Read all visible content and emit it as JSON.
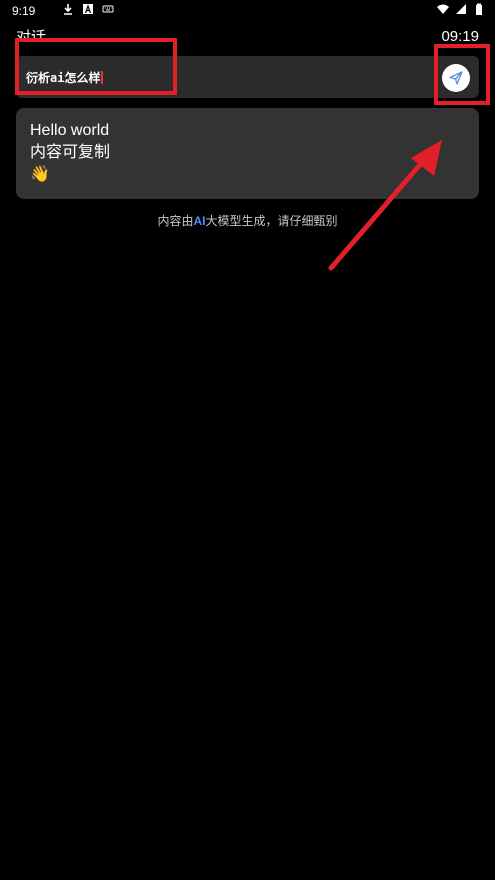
{
  "status_bar": {
    "time": "9:19"
  },
  "header": {
    "title": "对话",
    "clock": "09:19"
  },
  "input": {
    "value": "衍析ai怎么样"
  },
  "message": {
    "line1": "Hello world",
    "line2": "内容可复制",
    "emoji": "👋"
  },
  "disclaimer": {
    "prefix": "内容由",
    "highlight": "AI",
    "suffix": "大模型生成，请仔细甄别"
  },
  "colors": {
    "annotation_red": "#e3202a",
    "ai_blue": "#4c8dff",
    "card_bg": "#333333",
    "input_bg": "#2b2b2b"
  }
}
